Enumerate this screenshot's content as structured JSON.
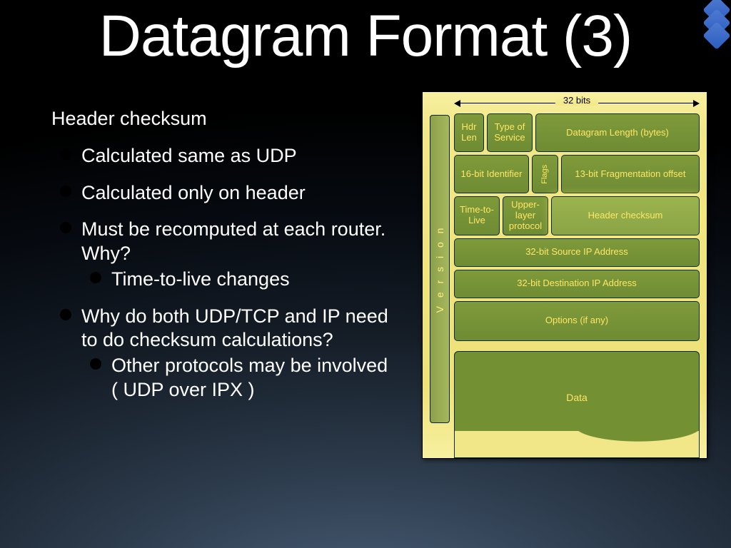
{
  "title": "Datagram Format (3)",
  "bullets": {
    "l1": "Header checksum",
    "l2a": "Calculated same as UDP",
    "l2b": "Calculated only on header",
    "l2c": "Must be recomputed at each router.  Why?",
    "l3a": "Time-to-live changes",
    "l2d": "Why do both UDP/TCP and IP need to do checksum calculations?",
    "l3b": "Other protocols may be involved ( UDP over IPX )"
  },
  "diagram": {
    "width_label": "32 bits",
    "vband": "V e r s i o n",
    "r1": {
      "hdrlen": "Hdr Len",
      "tos": "Type of Service",
      "len": "Datagram Length (bytes)"
    },
    "r2": {
      "id": "16-bit Identifier",
      "flags": "Flags",
      "frag": "13-bit Fragmentation offset"
    },
    "r3": {
      "ttl": "Time-to-Live",
      "proto": "Upper-layer protocol",
      "chk": "Header checksum"
    },
    "r4": "32-bit Source IP Address",
    "r5": "32-bit Destination IP Address",
    "r6": "Options (if any)",
    "data": "Data"
  }
}
